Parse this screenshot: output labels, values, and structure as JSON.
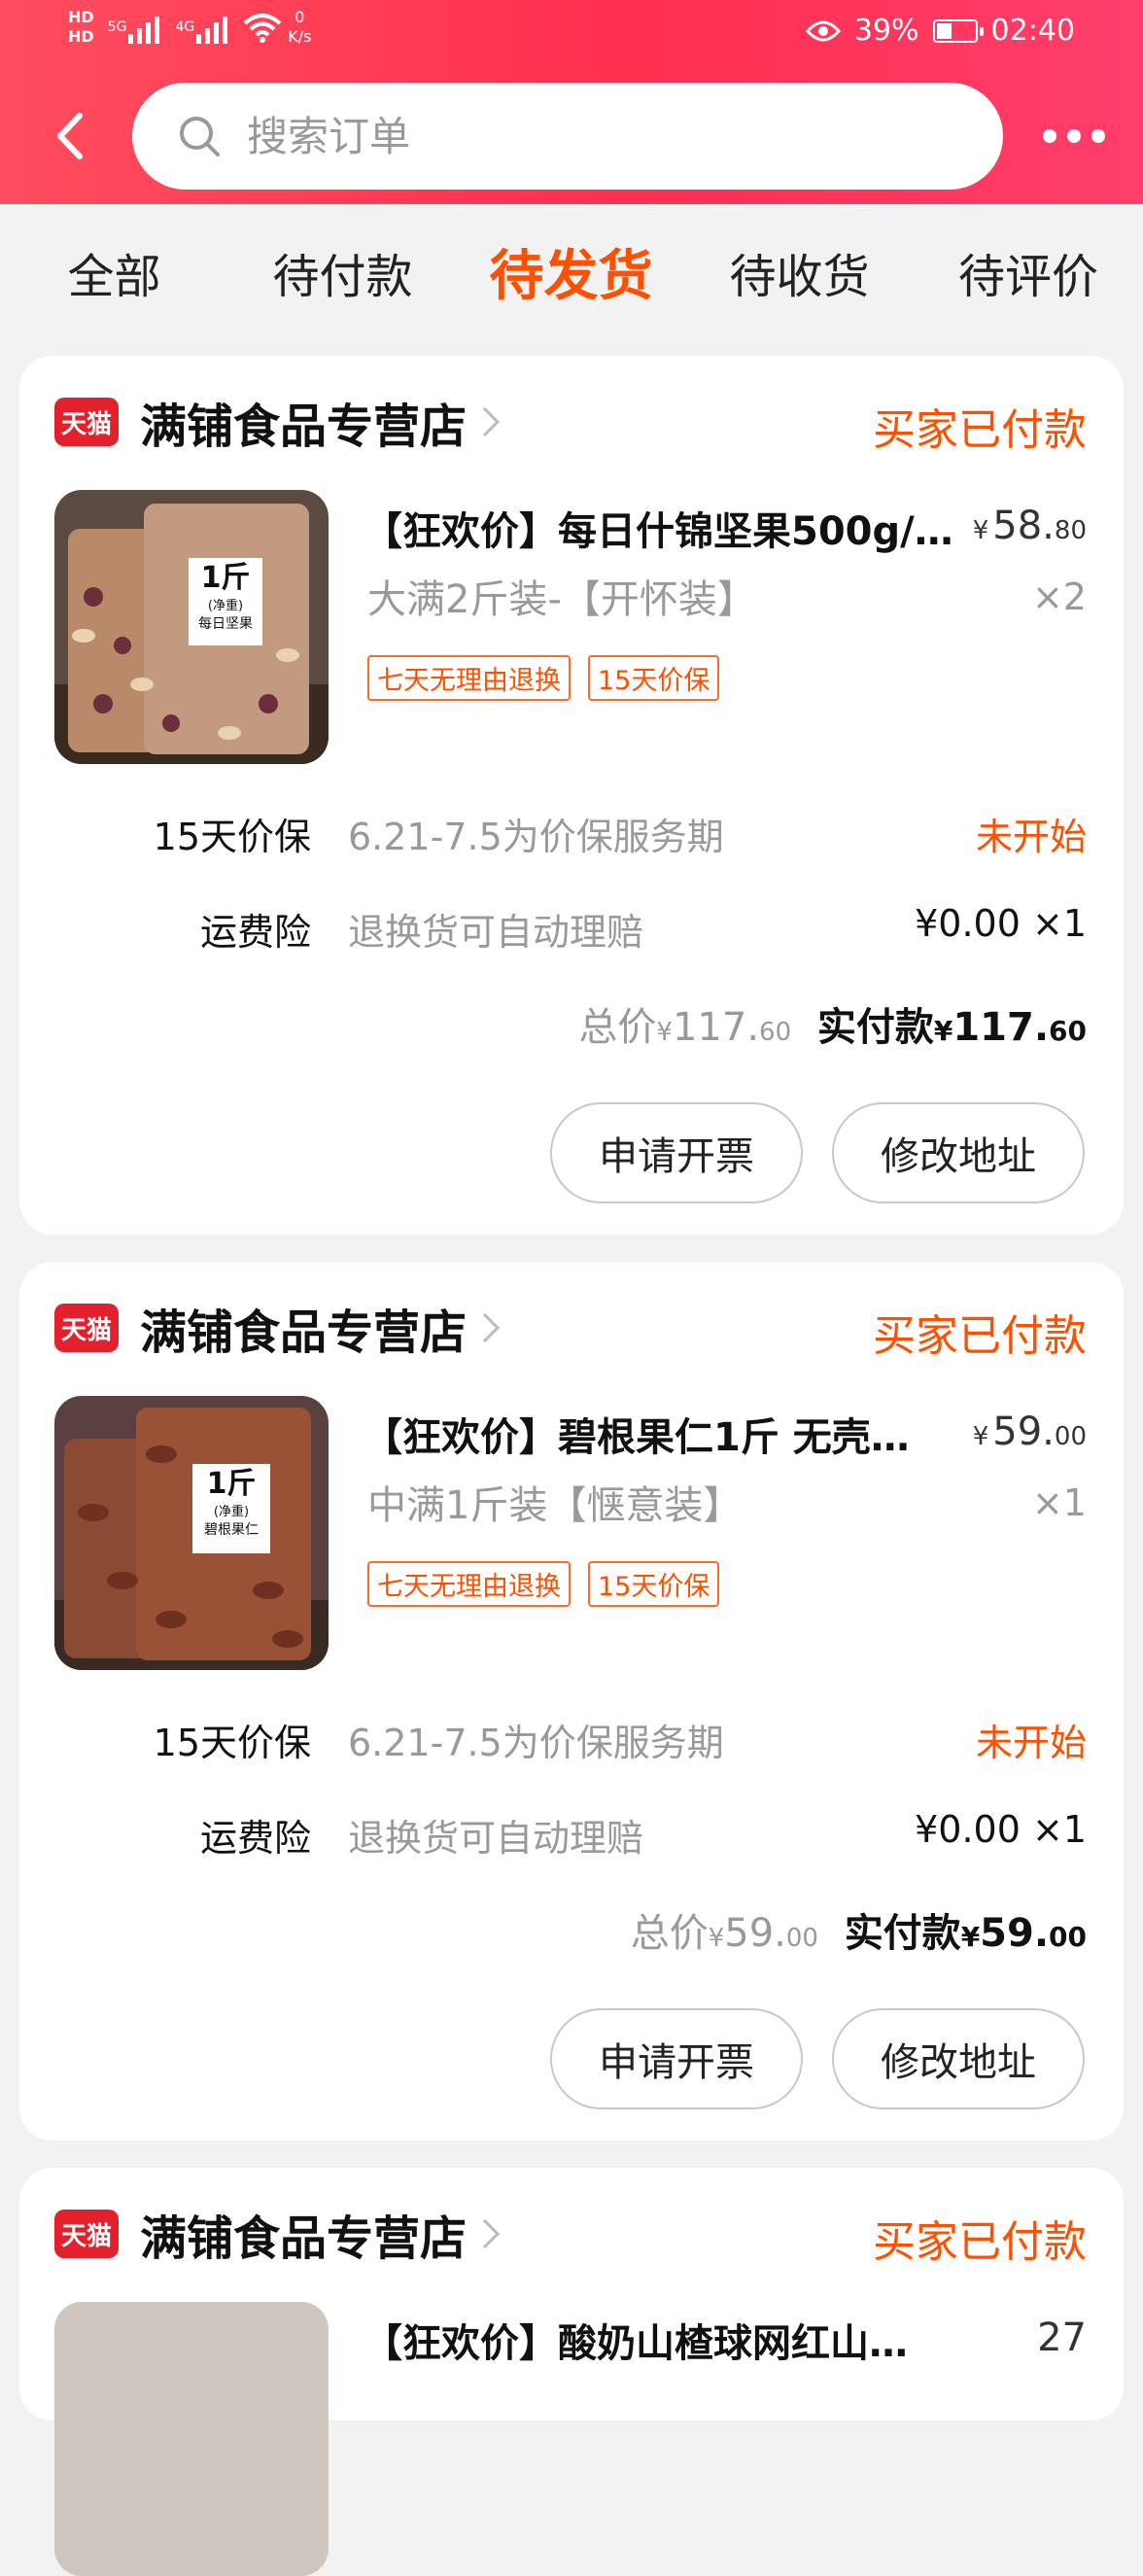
{
  "status_bar": {
    "hd1": "HD",
    "hd2": "HD",
    "net_1": "5G",
    "net_2": "4G",
    "speed_value": "0",
    "speed_unit": "K/s",
    "battery": "39%",
    "time": "02:40"
  },
  "search": {
    "placeholder": "搜索订单"
  },
  "tabs": [
    {
      "label": "全部",
      "active": false
    },
    {
      "label": "待付款",
      "active": false
    },
    {
      "label": "待发货",
      "active": true
    },
    {
      "label": "待收货",
      "active": false
    },
    {
      "label": "待评价",
      "active": false
    }
  ],
  "orders": [
    {
      "shop_badge": "天猫",
      "shop_name": "满铺食品专营店",
      "status": "买家已付款",
      "product": {
        "title": "【狂欢价】每日什锦坚果500g/…",
        "spec": "大满2斤装-【开怀装】",
        "badges": [
          "七天无理由退换",
          "15天价保"
        ],
        "price_currency": "¥",
        "price_int": "58.",
        "price_dec": "80",
        "qty": "×2",
        "image_label_1": "1斤",
        "image_label_2": "(净重)",
        "image_label_3": "每日坚果"
      },
      "protection": {
        "label": "15天价保",
        "desc": "6.21-7.5为价保服务期",
        "status": "未开始"
      },
      "shipping_ins": {
        "label": "运费险",
        "desc": "退换货可自动理赔",
        "value": "¥0.00 ×1"
      },
      "total": {
        "label": "总价",
        "currency": "¥",
        "int": "117.",
        "dec": "60"
      },
      "paid": {
        "label": "实付款",
        "currency": "¥",
        "int": "117.",
        "dec": "60"
      },
      "buttons": {
        "invoice": "申请开票",
        "address": "修改地址"
      }
    },
    {
      "shop_badge": "天猫",
      "shop_name": "满铺食品专营店",
      "status": "买家已付款",
      "product": {
        "title": "【狂欢价】碧根果仁1斤 无壳…",
        "spec": "中满1斤装【惬意装】",
        "badges": [
          "七天无理由退换",
          "15天价保"
        ],
        "price_currency": "¥",
        "price_int": "59.",
        "price_dec": "00",
        "qty": "×1",
        "image_label_1": "1斤",
        "image_label_2": "(净重)",
        "image_label_3": "碧根果仁"
      },
      "protection": {
        "label": "15天价保",
        "desc": "6.21-7.5为价保服务期",
        "status": "未开始"
      },
      "shipping_ins": {
        "label": "运费险",
        "desc": "退换货可自动理赔",
        "value": "¥0.00 ×1"
      },
      "total": {
        "label": "总价",
        "currency": "¥",
        "int": "59.",
        "dec": "00"
      },
      "paid": {
        "label": "实付款",
        "currency": "¥",
        "int": "59.",
        "dec": "00"
      },
      "buttons": {
        "invoice": "申请开票",
        "address": "修改地址"
      }
    },
    {
      "shop_badge": "天猫",
      "shop_name": "满铺食品专营店",
      "status": "买家已付款",
      "product": {
        "title": "【狂欢价】酸奶山楂球网红山…",
        "price_int": "27"
      }
    }
  ],
  "colors": {
    "header_red": "#ff2f4f",
    "accent_orange": "#ff5000",
    "tmall_red": "#e4202c"
  },
  "icons": {
    "back": "chevron-left-icon",
    "search": "search-icon",
    "more": "more-dots-icon",
    "shop_arrow": "chevron-right-icon"
  }
}
